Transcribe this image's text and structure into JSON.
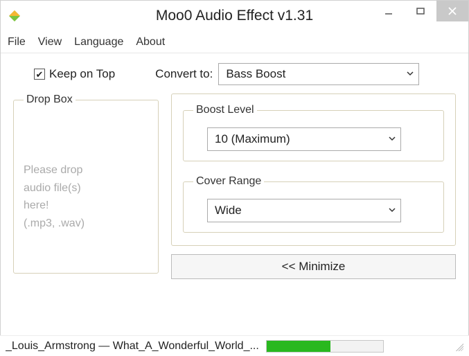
{
  "window": {
    "title": "Moo0 Audio Effect v1.31"
  },
  "menubar": {
    "file": "File",
    "view": "View",
    "language": "Language",
    "about": "About"
  },
  "keep_on_top": {
    "label": "Keep on Top",
    "checked": true
  },
  "convert": {
    "label": "Convert to:",
    "value": "Bass Boost"
  },
  "dropbox": {
    "legend": "Drop Box",
    "hint_line1": "Please drop",
    "hint_line2": "audio file(s)",
    "hint_line3": "here!",
    "hint_line4": "(.mp3, .wav)"
  },
  "settings": {
    "boost_level": {
      "legend": "Boost Level",
      "value": "10 (Maximum)"
    },
    "cover_range": {
      "legend": "Cover Range",
      "value": "Wide"
    }
  },
  "minimize_label": "<< Minimize",
  "status": {
    "text": "_Louis_Armstrong — What_A_Wonderful_World_...",
    "progress_percent": 55
  }
}
